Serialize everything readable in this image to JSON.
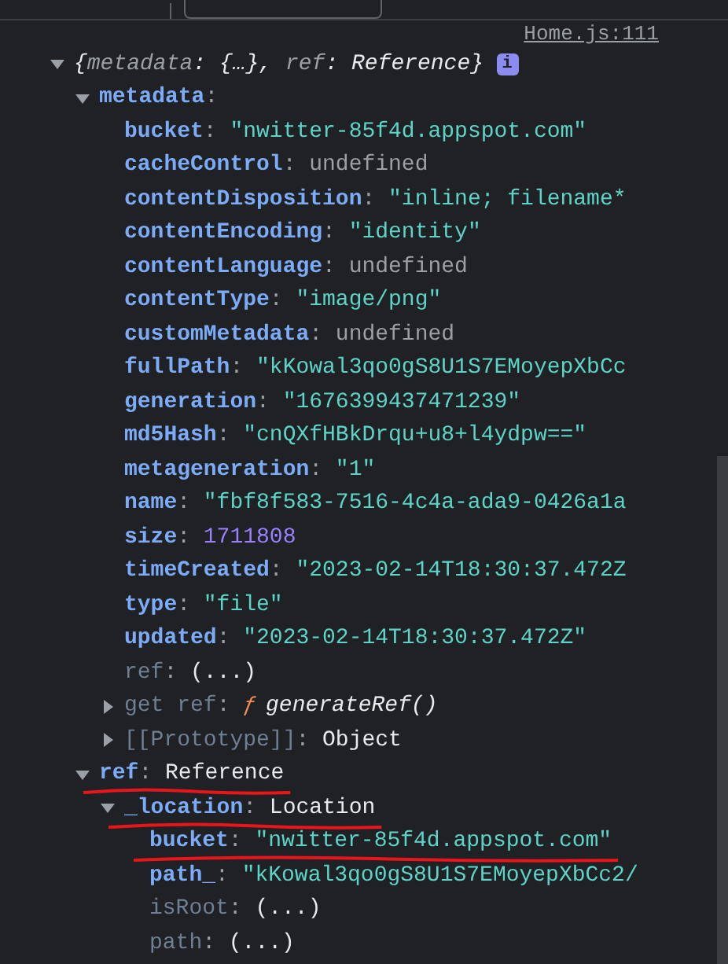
{
  "source_link": "Home.js:111",
  "separator": ":",
  "tree": [
    {
      "kind": "preview",
      "expanded": true,
      "underlined": false,
      "info": "i",
      "preview": [
        {
          "text": "{",
          "kind": "punct"
        },
        {
          "text": "metadata",
          "kind": "key"
        },
        {
          "text": ": ",
          "kind": "punct"
        },
        {
          "text": "{…}",
          "kind": "value"
        },
        {
          "text": ", ",
          "kind": "punct"
        },
        {
          "text": "ref",
          "kind": "key"
        },
        {
          "text": ": ",
          "kind": "punct"
        },
        {
          "text": "Reference",
          "kind": "value"
        },
        {
          "text": "}",
          "kind": "punct"
        }
      ],
      "children": [
        {
          "key": "metadata",
          "kind": "group",
          "expanded": true,
          "dim": false,
          "underlined": false,
          "children": [
            {
              "key": "bucket",
              "value": "\"nwitter-85f4d.appspot.com\"",
              "kind": "string",
              "dim": false,
              "underlined": false
            },
            {
              "key": "cacheControl",
              "value": "undefined",
              "kind": "undefined",
              "dim": false,
              "underlined": false
            },
            {
              "key": "contentDisposition",
              "value": "\"inline; filename*",
              "kind": "string",
              "dim": false,
              "underlined": false
            },
            {
              "key": "contentEncoding",
              "value": "\"identity\"",
              "kind": "string",
              "dim": false,
              "underlined": false
            },
            {
              "key": "contentLanguage",
              "value": "undefined",
              "kind": "undefined",
              "dim": false,
              "underlined": false
            },
            {
              "key": "contentType",
              "value": "\"image/png\"",
              "kind": "string",
              "dim": false,
              "underlined": false
            },
            {
              "key": "customMetadata",
              "value": "undefined",
              "kind": "undefined",
              "dim": false,
              "underlined": false
            },
            {
              "key": "fullPath",
              "value": "\"kKowal3qo0gS8U1S7EMoyepXbCc",
              "kind": "string",
              "dim": false,
              "underlined": false
            },
            {
              "key": "generation",
              "value": "\"1676399437471239\"",
              "kind": "string",
              "dim": false,
              "underlined": false
            },
            {
              "key": "md5Hash",
              "value": "\"cnQXfHBkDrqu+u8+l4ydpw==\"",
              "kind": "string",
              "dim": false,
              "underlined": false
            },
            {
              "key": "metageneration",
              "value": "\"1\"",
              "kind": "string",
              "dim": false,
              "underlined": false
            },
            {
              "key": "name",
              "value": "\"fbf8f583-7516-4c4a-ada9-0426a1a",
              "kind": "string",
              "dim": false,
              "underlined": false
            },
            {
              "key": "size",
              "value": "1711808",
              "kind": "number",
              "dim": false,
              "underlined": false
            },
            {
              "key": "timeCreated",
              "value": "\"2023-02-14T18:30:37.472Z",
              "kind": "string",
              "dim": false,
              "underlined": false
            },
            {
              "key": "type",
              "value": "\"file\"",
              "kind": "string",
              "dim": false,
              "underlined": false
            },
            {
              "key": "updated",
              "value": "\"2023-02-14T18:30:37.472Z\"",
              "kind": "string",
              "dim": false,
              "underlined": false
            },
            {
              "key": "ref",
              "value": "(...)",
              "kind": "object",
              "dim": true,
              "underlined": false
            },
            {
              "key": "get ref",
              "marker": "ƒ",
              "value": "generateRef()",
              "kind": "function",
              "expanded": false,
              "dim": true,
              "underlined": false
            },
            {
              "key": "[[Prototype]]",
              "value": "Object",
              "kind": "object",
              "expanded": false,
              "dim": true,
              "underlined": false
            }
          ]
        },
        {
          "key": "ref",
          "value": "Reference",
          "kind": "object",
          "expanded": true,
          "dim": false,
          "underlined": true,
          "children": [
            {
              "key": "_location",
              "value": "Location",
              "kind": "object",
              "expanded": true,
              "dim": false,
              "underlined": true,
              "children": [
                {
                  "key": "bucket",
                  "value": "\"nwitter-85f4d.appspot.com\"",
                  "kind": "string",
                  "dim": false,
                  "underlined": true
                },
                {
                  "key": "path_",
                  "value": "\"kKowal3qo0gS8U1S7EMoyepXbCc2/",
                  "kind": "string",
                  "dim": false,
                  "underlined": false
                },
                {
                  "key": "isRoot",
                  "value": "(...)",
                  "kind": "object",
                  "dim": true,
                  "underlined": false
                },
                {
                  "key": "path",
                  "value": "(...)",
                  "kind": "object",
                  "dim": true,
                  "underlined": false
                }
              ]
            }
          ]
        }
      ]
    }
  ]
}
